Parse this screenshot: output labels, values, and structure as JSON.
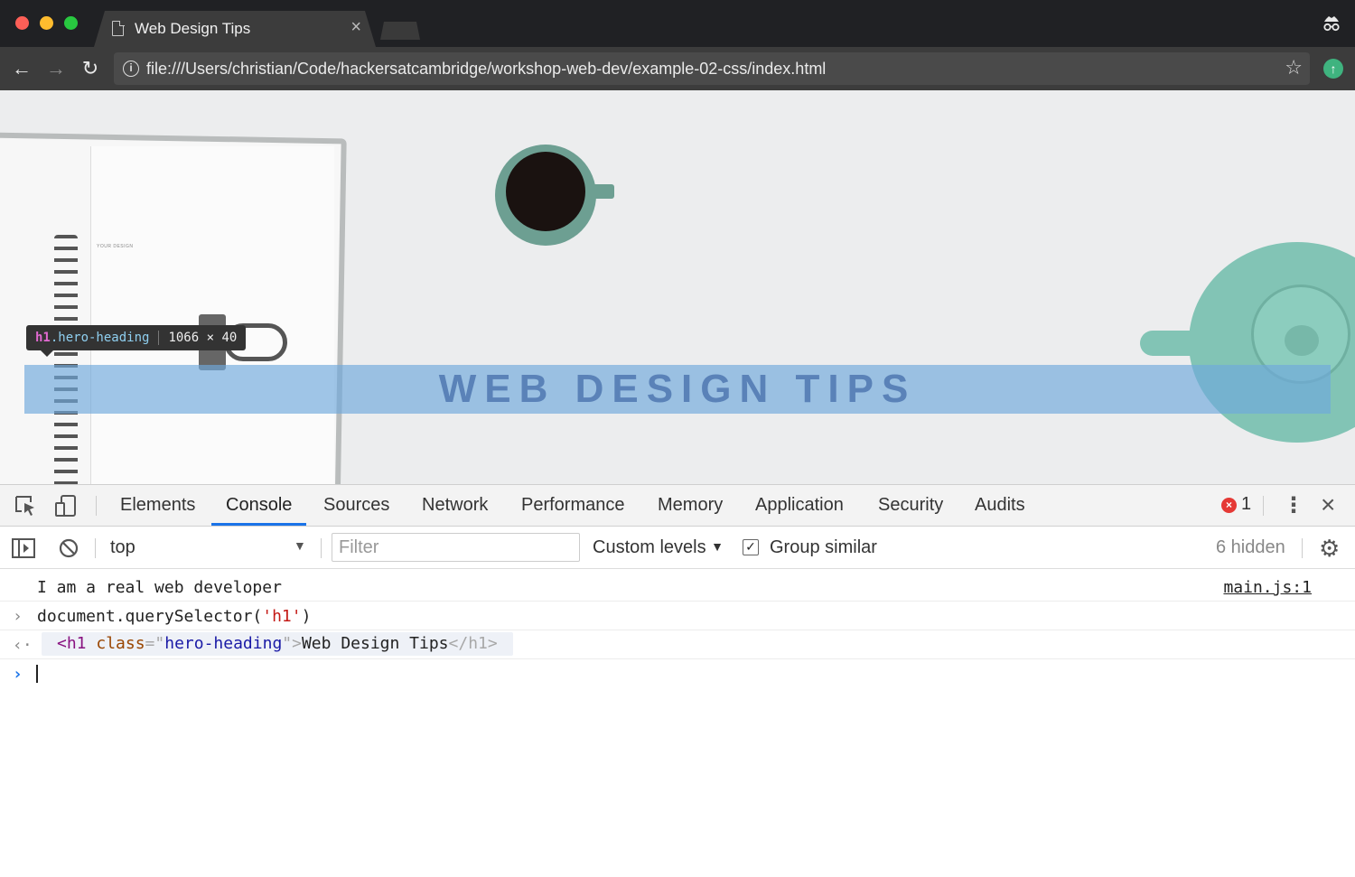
{
  "browser": {
    "tab_title": "Web Design Tips",
    "tab_close": "×",
    "url": "file:///Users/christian/Code/hackersatcambridge/workshop-web-dev/example-02-css/index.html",
    "icons": {
      "back": "arrow-left",
      "forward": "arrow-right",
      "reload": "reload",
      "info": "info",
      "star": "star",
      "extension": "arrow-up-circle",
      "incognito": "incognito"
    }
  },
  "page": {
    "hero_heading": "WEB DESIGN TIPS",
    "notebook_brand": "YOUR DESIGN",
    "inspect_tooltip": {
      "tag": "h1",
      "class": ".hero-heading",
      "dimensions": "1066 × 40"
    },
    "highlight_color": "#6fa8dc"
  },
  "devtools": {
    "tabs": [
      "Elements",
      "Console",
      "Sources",
      "Network",
      "Performance",
      "Memory",
      "Application",
      "Security",
      "Audits"
    ],
    "active_tab": "Console",
    "error_count": "1",
    "console_toolbar": {
      "context": "top",
      "filter_placeholder": "Filter",
      "levels": "Custom levels",
      "group_similar": "Group similar",
      "group_similar_checked": true,
      "hidden": "6 hidden"
    },
    "console": {
      "log_message": "I am a real web developer",
      "log_source": "main.js:1",
      "command_prefix": "document.querySelector(",
      "command_arg": "'h1'",
      "command_suffix": ")",
      "result": {
        "open_tag": "<h1",
        "attr_name": " class",
        "attr_eq": "=\"",
        "attr_value": "hero-heading",
        "attr_close": "\">",
        "text": "Web Design Tips",
        "close_tag": "</h1>"
      }
    }
  }
}
